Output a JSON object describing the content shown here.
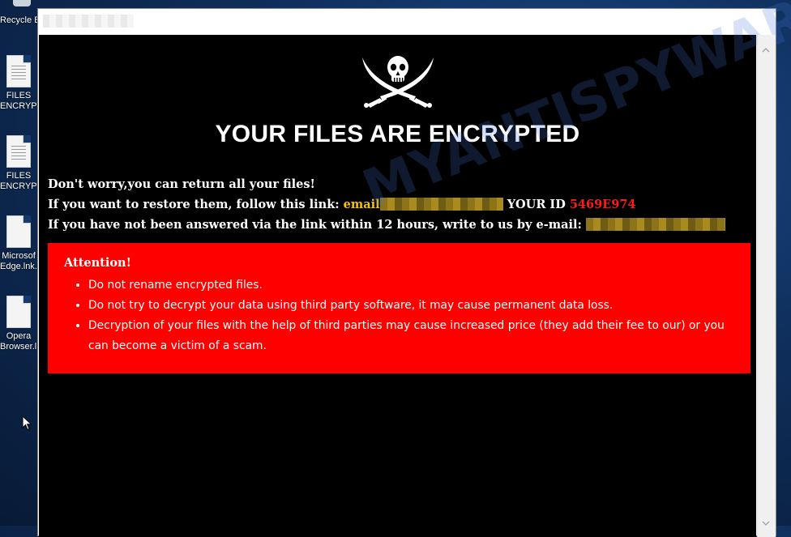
{
  "desktop": {
    "recycle_label": "Recycle B",
    "icons": [
      {
        "label1": "FILES",
        "label2": "ENCRYPTE"
      },
      {
        "label1": "FILES",
        "label2": "ENCRYPTE"
      },
      {
        "label1": "Microsof",
        "label2": "Edge.lnk.id"
      },
      {
        "label1": "Opera",
        "label2": "Browser.ln"
      }
    ]
  },
  "note": {
    "headline": "YOUR FILES ARE ENCRYPTED",
    "line1": "Don't worry,you can return all your files!",
    "line2_prefix": "If you want to restore them, follow this link: ",
    "line2_email": "email",
    "line2_id_label": " YOUR ID ",
    "line2_id_value": "5469E974",
    "line3_prefix": "If you have not been answered via the link within 12 hours, write to us by e-mail:",
    "attention_title": "Attention!",
    "bullets": [
      "Do not rename encrypted files.",
      "Do not try to decrypt your data using third party software, it may cause permanent data loss.",
      "Decryption of your files with the help of third parties may cause increased price (they add their fee to our) or you can become a victim of a scam."
    ],
    "watermark": "MYANTISPYWARE.COM"
  },
  "colors": {
    "alert_bg": "#ff0000",
    "email_yellow": "#f4c20d",
    "id_red": "#ff1a1a",
    "background": "#000000"
  }
}
